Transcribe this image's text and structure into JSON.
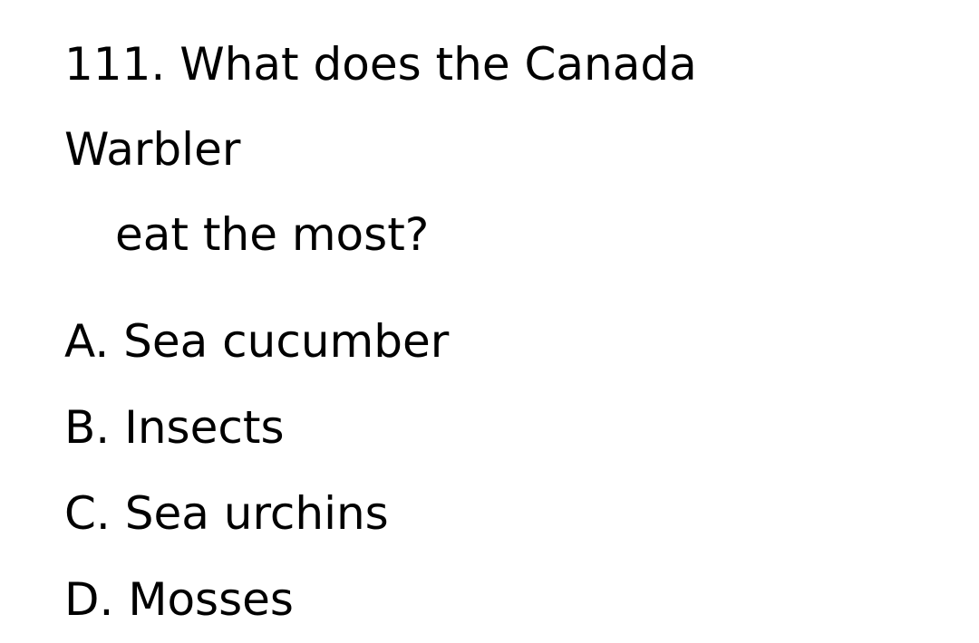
{
  "question": {
    "number": "111.",
    "text_line1": "What does the Canada Warbler",
    "text_line2": "eat the most?"
  },
  "options": [
    {
      "letter": "A.",
      "text": "Sea cucumber"
    },
    {
      "letter": "B.",
      "text": "Insects"
    },
    {
      "letter": "C.",
      "text": "Sea urchins"
    },
    {
      "letter": "D.",
      "text": "Mosses"
    }
  ]
}
